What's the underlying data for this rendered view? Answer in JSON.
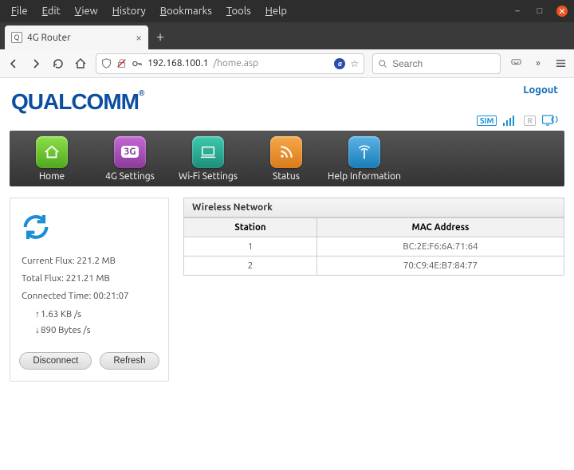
{
  "menu": [
    "File",
    "Edit",
    "View",
    "History",
    "Bookmarks",
    "Tools",
    "Help"
  ],
  "tab": {
    "title": "4G Router"
  },
  "url": {
    "host": "192.168.100.1",
    "path": "/home.asp"
  },
  "search": {
    "placeholder": "Search"
  },
  "logout": "Logout",
  "logo": "QUALCOMM",
  "statusicons": {
    "sim": "SIM",
    "r": "R"
  },
  "nav": [
    {
      "label": "Home"
    },
    {
      "label": "4G Settings",
      "badge": "3G"
    },
    {
      "label": "Wi-Fi Settings"
    },
    {
      "label": "Status"
    },
    {
      "label": "Help Information"
    }
  ],
  "left": {
    "current_flux_label": "Current Flux:",
    "current_flux_value": "221.2 MB",
    "total_flux_label": "Total Flux:",
    "total_flux_value": "221.21 MB",
    "connected_label": "Connected Time:",
    "connected_value": "00:21:07",
    "up_speed": "1.63 KB /s",
    "down_speed": "890 Bytes /s",
    "disconnect": "Disconnect",
    "refresh": "Refresh"
  },
  "wireless": {
    "title": "Wireless Network",
    "col_station": "Station",
    "col_mac": "MAC Address",
    "rows": [
      {
        "station": "1",
        "mac": "BC:2E:F6:6A:71:64"
      },
      {
        "station": "2",
        "mac": "70:C9:4E:B7:84:77"
      }
    ]
  }
}
